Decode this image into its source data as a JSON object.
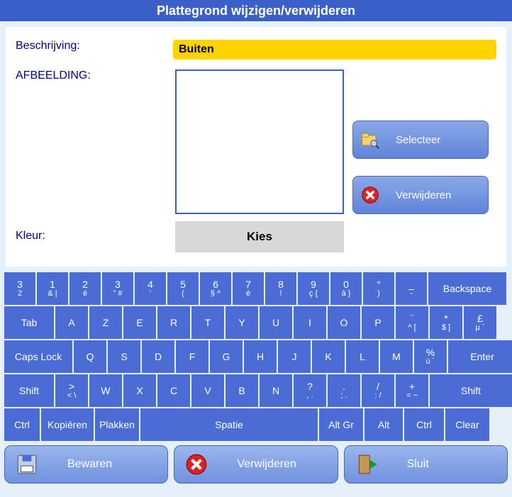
{
  "title": "Plattegrond wijzigen/verwijderen",
  "labels": {
    "beschrijving": "Beschrijving:",
    "afbeelding": "AFBEELDING:",
    "kleur": "Kleur:"
  },
  "inputs": {
    "beschrijving_value": "Buiten"
  },
  "buttons": {
    "selecteer": "Selecteer",
    "verwijderen": "Verwijderen",
    "kies": "Kies",
    "bewaren": "Bewaren",
    "verwijderen_footer": "Verwijderen",
    "sluit": "Sluit"
  },
  "keyboard": {
    "row1": [
      {
        "top": "3",
        "bot": "2"
      },
      {
        "top": "1",
        "bot": "& |"
      },
      {
        "top": "2",
        "bot": "é"
      },
      {
        "top": "3",
        "bot": "\" #"
      },
      {
        "top": "4",
        "bot": "'"
      },
      {
        "top": "5",
        "bot": "("
      },
      {
        "top": "6",
        "bot": "§ ^"
      },
      {
        "top": "7",
        "bot": "è"
      },
      {
        "top": "8",
        "bot": "!"
      },
      {
        "top": "9",
        "bot": "ç {"
      },
      {
        "top": "0",
        "bot": "à }"
      },
      {
        "top": "°",
        "bot": ")"
      },
      {
        "top": "_",
        "bot": "-"
      },
      {
        "top": "Backspace",
        "bot": ""
      }
    ],
    "row2": [
      {
        "top": "Tab",
        "bot": ""
      },
      {
        "top": "A",
        "bot": ""
      },
      {
        "top": "Z",
        "bot": ""
      },
      {
        "top": "E",
        "bot": ""
      },
      {
        "top": "R",
        "bot": ""
      },
      {
        "top": "T",
        "bot": ""
      },
      {
        "top": "Y",
        "bot": ""
      },
      {
        "top": "U",
        "bot": ""
      },
      {
        "top": "I",
        "bot": ""
      },
      {
        "top": "O",
        "bot": ""
      },
      {
        "top": "P",
        "bot": ""
      },
      {
        "top": "¨",
        "bot": "^ ["
      },
      {
        "top": "*",
        "bot": "$ ]"
      },
      {
        "top": "£",
        "bot": "µ `"
      }
    ],
    "row3": [
      {
        "top": "Caps Lock",
        "bot": ""
      },
      {
        "top": "Q",
        "bot": ""
      },
      {
        "top": "S",
        "bot": ""
      },
      {
        "top": "D",
        "bot": ""
      },
      {
        "top": "F",
        "bot": ""
      },
      {
        "top": "G",
        "bot": ""
      },
      {
        "top": "H",
        "bot": ""
      },
      {
        "top": "J",
        "bot": ""
      },
      {
        "top": "K",
        "bot": ""
      },
      {
        "top": "L",
        "bot": ""
      },
      {
        "top": "M",
        "bot": ""
      },
      {
        "top": "%",
        "bot": "ù ´"
      },
      {
        "top": "Enter",
        "bot": ""
      }
    ],
    "row4": [
      {
        "top": "Shift",
        "bot": ""
      },
      {
        "top": ">",
        "bot": "< \\"
      },
      {
        "top": "W",
        "bot": ""
      },
      {
        "top": "X",
        "bot": ""
      },
      {
        "top": "C",
        "bot": ""
      },
      {
        "top": "V",
        "bot": ""
      },
      {
        "top": "B",
        "bot": ""
      },
      {
        "top": "N",
        "bot": ""
      },
      {
        "top": "?",
        "bot": ", ."
      },
      {
        "top": ".",
        "bot": "; ."
      },
      {
        "top": "/",
        "bot": ": /"
      },
      {
        "top": "+",
        "bot": "= ~"
      },
      {
        "top": "Shift",
        "bot": ""
      }
    ],
    "row5": [
      {
        "top": "Ctrl",
        "bot": ""
      },
      {
        "top": "Kopiëren",
        "bot": ""
      },
      {
        "top": "Plakken",
        "bot": ""
      },
      {
        "top": "Spatie",
        "bot": ""
      },
      {
        "top": "Alt Gr",
        "bot": ""
      },
      {
        "top": "Alt",
        "bot": ""
      },
      {
        "top": "Ctrl",
        "bot": ""
      },
      {
        "top": "Clear",
        "bot": ""
      }
    ],
    "widths": {
      "row1": [
        44,
        44,
        44,
        44,
        44,
        44,
        44,
        44,
        44,
        44,
        44,
        44,
        44,
        110
      ],
      "row2": [
        70,
        46,
        46,
        46,
        46,
        46,
        46,
        46,
        46,
        46,
        46,
        46,
        46,
        46
      ],
      "row3": [
        96,
        46,
        46,
        46,
        46,
        46,
        46,
        46,
        46,
        46,
        46,
        46,
        96
      ],
      "row4": [
        70,
        46,
        46,
        46,
        46,
        46,
        46,
        46,
        46,
        46,
        46,
        46,
        116
      ],
      "row5": [
        50,
        74,
        62,
        250,
        62,
        54,
        56,
        62
      ]
    }
  }
}
